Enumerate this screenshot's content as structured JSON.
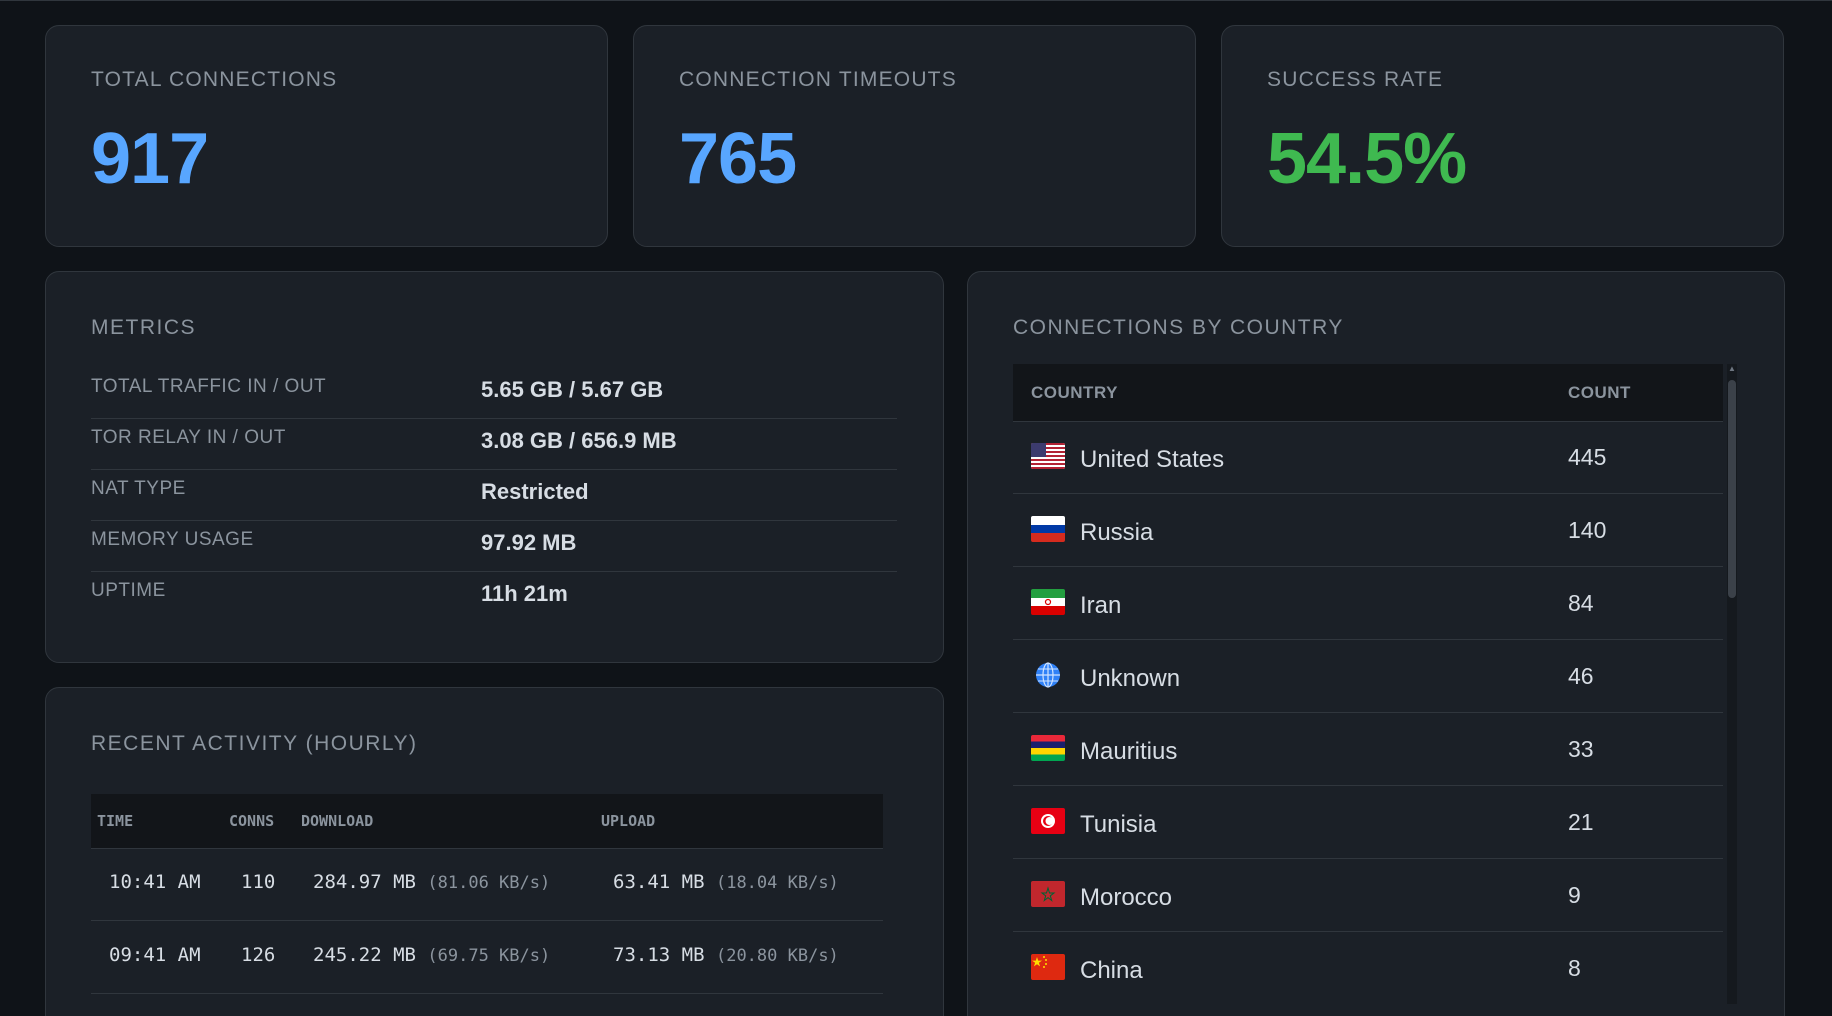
{
  "stats": [
    {
      "label": "TOTAL CONNECTIONS",
      "value": "917",
      "color": "#58a6ff"
    },
    {
      "label": "CONNECTION TIMEOUTS",
      "value": "765",
      "color": "#58a6ff"
    },
    {
      "label": "SUCCESS RATE",
      "value": "54.5%",
      "color": "#3fb950"
    }
  ],
  "metrics": {
    "title": "METRICS",
    "rows": [
      {
        "label": "TOTAL TRAFFIC IN / OUT",
        "value": "5.65 GB / 5.67 GB"
      },
      {
        "label": "TOR RELAY IN / OUT",
        "value": "3.08 GB / 656.9 MB"
      },
      {
        "label": "NAT TYPE",
        "value": "Restricted"
      },
      {
        "label": "MEMORY USAGE",
        "value": "97.92 MB"
      },
      {
        "label": "UPTIME",
        "value": "11h 21m"
      }
    ]
  },
  "activity": {
    "title": "RECENT ACTIVITY (HOURLY)",
    "headers": {
      "time": "TIME",
      "conns": "CONNS",
      "download": "DOWNLOAD",
      "upload": "UPLOAD"
    },
    "rows": [
      {
        "time": "10:41 AM",
        "conns": "110",
        "download": "284.97 MB",
        "download_rate": "(81.06 KB/s)",
        "upload": "63.41 MB",
        "upload_rate": "(18.04 KB/s)"
      },
      {
        "time": "09:41 AM",
        "conns": "126",
        "download": "245.22 MB",
        "download_rate": "(69.75 KB/s)",
        "upload": "73.13 MB",
        "upload_rate": "(20.80 KB/s)"
      }
    ]
  },
  "countries": {
    "title": "CONNECTIONS BY COUNTRY",
    "headers": {
      "country": "COUNTRY",
      "count": "COUNT"
    },
    "rows": [
      {
        "name": "United States",
        "count": "445",
        "flag": "us-flag-icon"
      },
      {
        "name": "Russia",
        "count": "140",
        "flag": "ru-flag-icon"
      },
      {
        "name": "Iran",
        "count": "84",
        "flag": "ir-flag-icon"
      },
      {
        "name": "Unknown",
        "count": "46",
        "flag": "globe-icon"
      },
      {
        "name": "Mauritius",
        "count": "33",
        "flag": "mu-flag-icon"
      },
      {
        "name": "Tunisia",
        "count": "21",
        "flag": "tn-flag-icon"
      },
      {
        "name": "Morocco",
        "count": "9",
        "flag": "ma-flag-icon"
      },
      {
        "name": "China",
        "count": "8",
        "flag": "cn-flag-icon"
      }
    ]
  }
}
